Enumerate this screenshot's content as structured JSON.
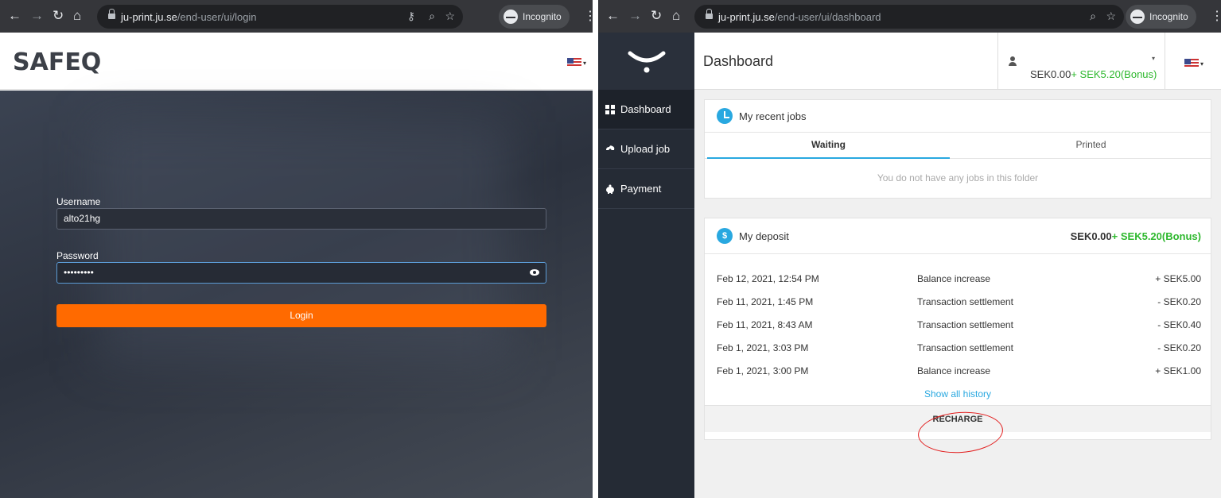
{
  "left": {
    "browser": {
      "url_host": "ju-print.ju.se",
      "url_path": "/end-user/ui/login",
      "incognito_label": "Incognito"
    },
    "logo": "SAFEQ",
    "login": {
      "username_label": "Username",
      "username_value": "alto21hg",
      "password_label": "Password",
      "password_value": "•••••••••",
      "login_button": "Login"
    }
  },
  "right": {
    "browser": {
      "url_host": "ju-print.ju.se",
      "url_path": "/end-user/ui/dashboard",
      "incognito_label": "Incognito"
    },
    "sidebar": {
      "items": [
        {
          "label": "Dashboard",
          "icon": "grid-icon"
        },
        {
          "label": "Upload job",
          "icon": "upload-icon"
        },
        {
          "label": "Payment",
          "icon": "piggy-bank-icon"
        }
      ]
    },
    "header": {
      "title": "Dashboard",
      "balance": "SEK0.00",
      "bonus": "+ SEK5.20(Bonus)"
    },
    "recent_jobs": {
      "title": "My recent jobs",
      "tabs": [
        "Waiting",
        "Printed"
      ],
      "empty_message": "You do not have any jobs in this folder"
    },
    "deposit": {
      "title": "My deposit",
      "balance": "SEK0.00",
      "bonus": "+ SEK5.20(Bonus)",
      "transactions": [
        {
          "date": "Feb 12, 2021, 12:54 PM",
          "type": "Balance increase",
          "amount": "+ SEK5.00"
        },
        {
          "date": "Feb 11, 2021, 1:45 PM",
          "type": "Transaction settlement",
          "amount": "- SEK0.20"
        },
        {
          "date": "Feb 11, 2021, 8:43 AM",
          "type": "Transaction settlement",
          "amount": "- SEK0.40"
        },
        {
          "date": "Feb 1, 2021, 3:03 PM",
          "type": "Transaction settlement",
          "amount": "- SEK0.20"
        },
        {
          "date": "Feb 1, 2021, 3:00 PM",
          "type": "Balance increase",
          "amount": "+ SEK1.00"
        }
      ],
      "history_link": "Show all history",
      "recharge": "RECHARGE"
    }
  },
  "colors": {
    "accent_orange": "#ff6a00",
    "accent_blue": "#29a8e0",
    "bonus_green": "#2eb82e",
    "annotation_red": "#e21c1c"
  }
}
